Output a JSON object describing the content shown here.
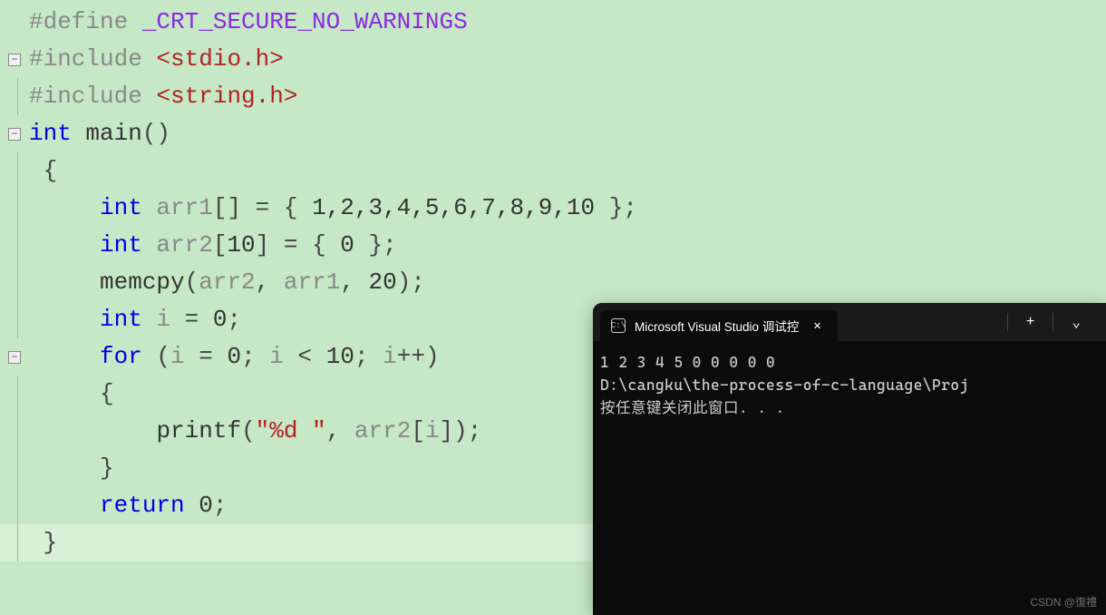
{
  "code": {
    "line1": {
      "preproc": "#define ",
      "macro": "_CRT_SECURE_NO_WARNINGS"
    },
    "line2": {
      "preproc": "#include ",
      "path": "<stdio.h>"
    },
    "line3": {
      "preproc": "#include ",
      "path": "<string.h>"
    },
    "line4": {
      "kw_int": "int",
      "func": " main",
      "parens": "()"
    },
    "line5": {
      "brace": "{"
    },
    "line6": {
      "kw": "int",
      "var": " arr1",
      "brackets": "[] = { ",
      "nums": "1,2,3,4,5,6,7,8,9,10",
      "end": " };"
    },
    "line7": {
      "kw": "int",
      "var": " arr2",
      "brackets": "[",
      "size": "10",
      "mid": "] = { ",
      "val": "0",
      "end": " };"
    },
    "line8": {
      "func": "memcpy",
      "open": "(",
      "arg1": "arr2",
      "comma1": ", ",
      "arg2": "arr1",
      "comma2": ", ",
      "arg3": "20",
      "close": ");"
    },
    "line9": {
      "kw": "int",
      "var": " i",
      "assign": " = ",
      "val": "0",
      "semi": ";"
    },
    "line10": {
      "kw": "for",
      "open": " (",
      "var1": "i",
      "eq": " = ",
      "zero": "0",
      "semi1": "; ",
      "var2": "i",
      "lt": " < ",
      "ten": "10",
      "semi2": "; ",
      "var3": "i",
      "inc": "++)"
    },
    "line11": {
      "brace": "{"
    },
    "line12": {
      "func": "printf",
      "open": "(",
      "str": "\"%d \"",
      "comma": ", ",
      "var": "arr2",
      "bopen": "[",
      "idx": "i",
      "bclose": "]",
      "close": ");"
    },
    "line13": {
      "brace": "}"
    },
    "line14": {
      "kw": "return",
      "val": " 0",
      "semi": ";"
    },
    "line15": {
      "brace": "}"
    }
  },
  "terminal": {
    "tab_title": "Microsoft Visual Studio 调试控",
    "tab_icon": "C:\\",
    "output_line1": "1 2 3 4 5 0 0 0 0 0",
    "output_line2": "D:\\cangku\\the-process-of-c-language\\Proj",
    "output_line3": "按任意键关闭此窗口. . ."
  },
  "watermark": "CSDN @復禮"
}
